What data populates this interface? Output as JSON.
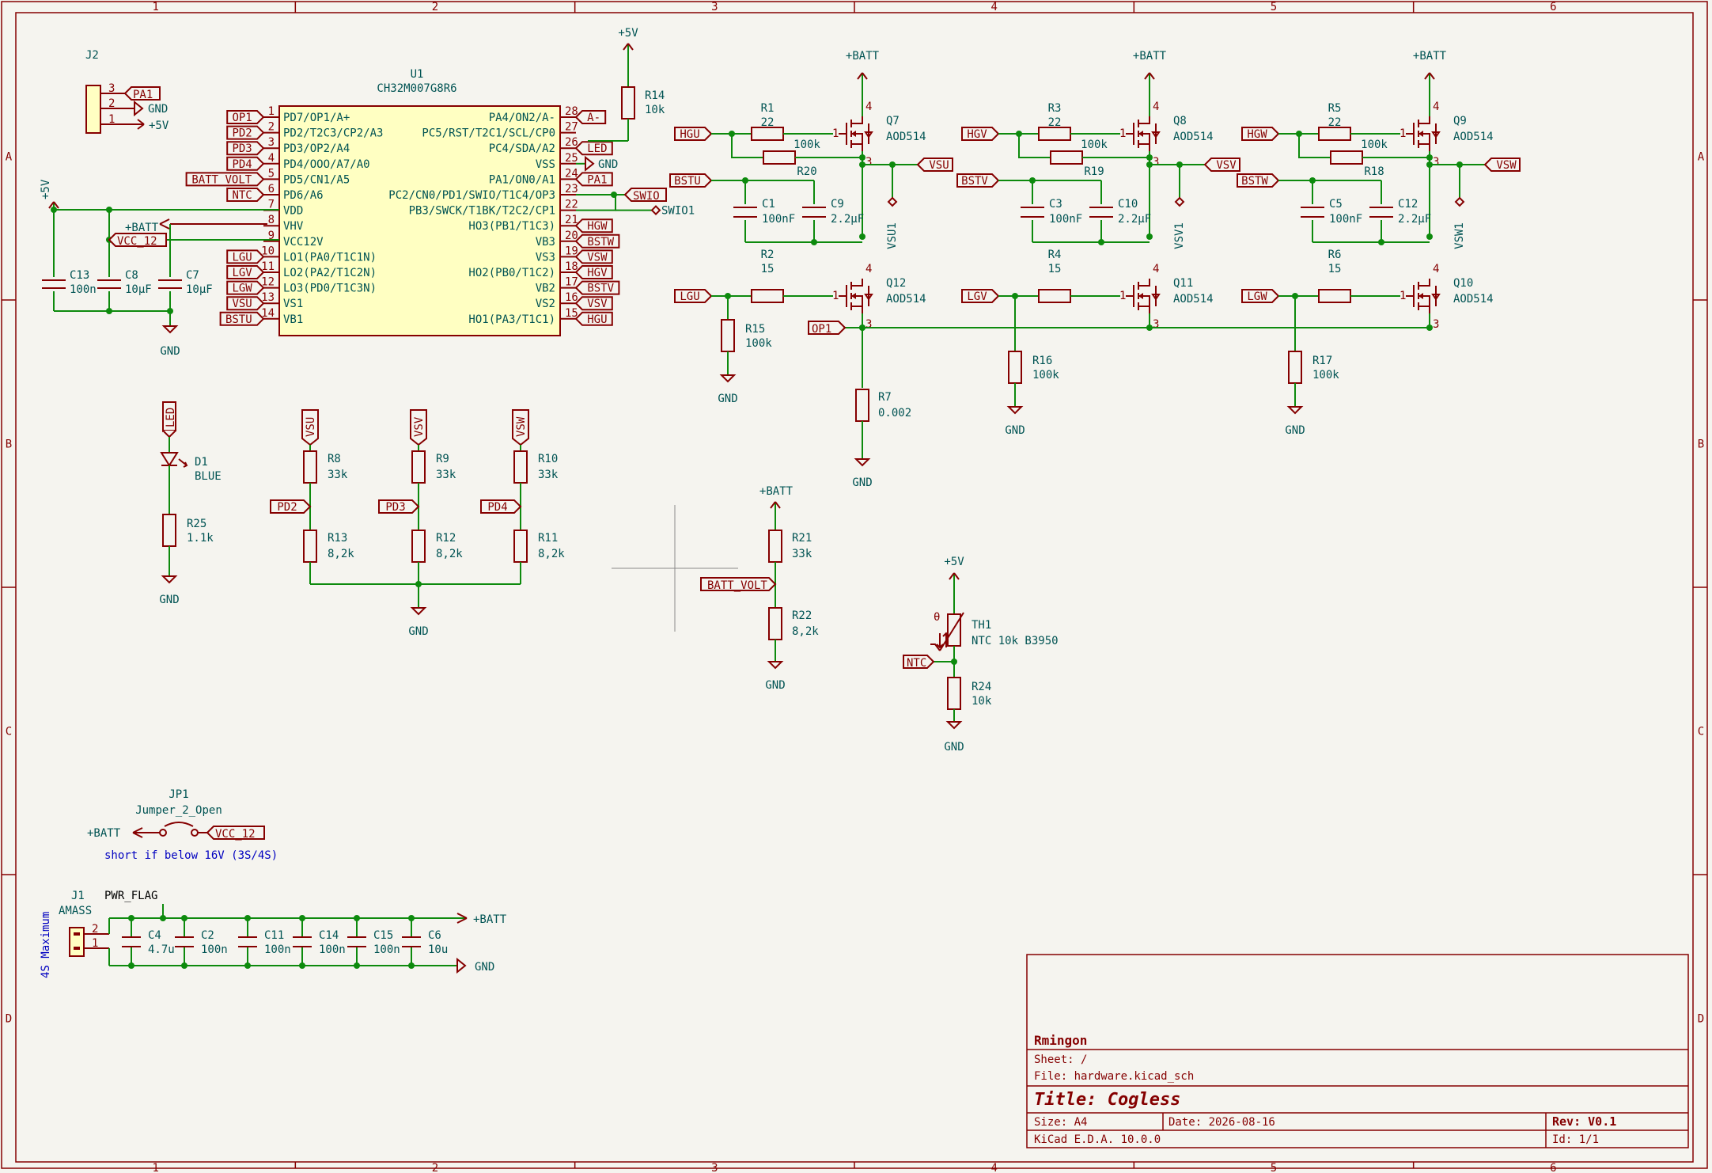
{
  "border": {
    "cols": [
      "1",
      "2",
      "3",
      "4",
      "5",
      "6"
    ],
    "rows": [
      "A",
      "B",
      "C",
      "D"
    ]
  },
  "colors": {
    "wire": "#0d8a0d",
    "symbol": "#850000",
    "text": "#005353",
    "body": "#ffffc2",
    "background": "#f5f4ef",
    "note": "#0000c0"
  },
  "mcu": {
    "ref": "U1",
    "value": "CH32M007G8R6",
    "left_pins": [
      {
        "num": "1",
        "name": "PD7/OP1/A+",
        "net": "OP1"
      },
      {
        "num": "2",
        "name": "PD2/T2C3/CP2/A3",
        "net": "PD2"
      },
      {
        "num": "3",
        "name": "PD3/OP2/A4",
        "net": "PD3"
      },
      {
        "num": "4",
        "name": "PD4/OOO/A7/A0",
        "net": "PD4"
      },
      {
        "num": "5",
        "name": "PD5/CN1/A5",
        "net": "BATT_VOLT"
      },
      {
        "num": "6",
        "name": "PD6/A6",
        "net": "NTC"
      },
      {
        "num": "7",
        "name": "VDD",
        "net": ""
      },
      {
        "num": "8",
        "name": "VHV",
        "net": ""
      },
      {
        "num": "9",
        "name": "VCC12V",
        "net": ""
      },
      {
        "num": "10",
        "name": "LO1(PA0/T1C1N)",
        "net": "LGU"
      },
      {
        "num": "11",
        "name": "LO2(PA2/T1C2N)",
        "net": "LGV"
      },
      {
        "num": "12",
        "name": "LO3(PD0/T1C3N)",
        "net": "LGW"
      },
      {
        "num": "13",
        "name": "VS1",
        "net": "VSU"
      },
      {
        "num": "14",
        "name": "VB1",
        "net": "BSTU"
      }
    ],
    "right_pins": [
      {
        "num": "28",
        "name": "PA4/ON2/A-",
        "net": "A-"
      },
      {
        "num": "27",
        "name": "PC5/RST/T2C1/SCL/CP0",
        "net": ""
      },
      {
        "num": "26",
        "name": "PC4/SDA/A2",
        "net": "LED"
      },
      {
        "num": "25",
        "name": "VSS",
        "net": "GND"
      },
      {
        "num": "24",
        "name": "PA1/ON0/A1",
        "net": "PA1"
      },
      {
        "num": "23",
        "name": "PC2/CN0/PD1/SWIO/T1C4/OP3",
        "net": "SWIO"
      },
      {
        "num": "22",
        "name": "PB3/SWCK/T1BK/T2C2/CP1",
        "net": "SWIO1"
      },
      {
        "num": "21",
        "name": "HO3(PB1/T1C3)",
        "net": "HGW"
      },
      {
        "num": "20",
        "name": "VB3",
        "net": "BSTW"
      },
      {
        "num": "19",
        "name": "VS3",
        "net": "VSW"
      },
      {
        "num": "18",
        "name": "HO2(PB0/T1C2)",
        "net": "HGV"
      },
      {
        "num": "17",
        "name": "VB2",
        "net": "BSTV"
      },
      {
        "num": "16",
        "name": "VS2",
        "net": "VSV"
      },
      {
        "num": "15",
        "name": "HO1(PA3/T1C1)",
        "net": "HGU"
      }
    ]
  },
  "j2": {
    "ref": "J2",
    "pins": [
      "3",
      "2",
      "1"
    ],
    "nets": [
      "PA1",
      "GND",
      "+5V"
    ]
  },
  "power_caps": [
    {
      "ref": "C13",
      "value": "100n"
    },
    {
      "ref": "C8",
      "value": "10μF"
    },
    {
      "ref": "C7",
      "value": "10μF"
    }
  ],
  "phases": [
    {
      "hg": "HGU",
      "bst": "BSTU",
      "lg": "LGU",
      "vs": "VSU",
      "probe": "VSU1",
      "rg1": {
        "ref": "R1",
        "value": "22"
      },
      "rbs": {
        "ref": "R20",
        "value": "100k"
      },
      "c1": {
        "ref": "C1",
        "value": "100nF"
      },
      "c2": {
        "ref": "C9",
        "value": "2.2μF"
      },
      "qh": {
        "ref": "Q7",
        "value": "AOD514"
      },
      "rg2": {
        "ref": "R2",
        "value": "15"
      },
      "ql": {
        "ref": "Q12",
        "value": "AOD514"
      },
      "rpd": {
        "ref": "R15",
        "value": "100k"
      }
    },
    {
      "hg": "HGV",
      "bst": "BSTV",
      "lg": "LGV",
      "vs": "VSV",
      "probe": "VSV1",
      "rg1": {
        "ref": "R3",
        "value": "22"
      },
      "rbs": {
        "ref": "R19",
        "value": "100k"
      },
      "c1": {
        "ref": "C3",
        "value": "100nF"
      },
      "c2": {
        "ref": "C10",
        "value": "2.2μF"
      },
      "qh": {
        "ref": "Q8",
        "value": "AOD514"
      },
      "rg2": {
        "ref": "R4",
        "value": "15"
      },
      "ql": {
        "ref": "Q11",
        "value": "AOD514"
      },
      "rpd": {
        "ref": "R16",
        "value": "100k"
      }
    },
    {
      "hg": "HGW",
      "bst": "BSTW",
      "lg": "LGW",
      "vs": "VSW",
      "probe": "VSW1",
      "rg1": {
        "ref": "R5",
        "value": "22"
      },
      "rbs": {
        "ref": "R18",
        "value": "100k"
      },
      "c1": {
        "ref": "C5",
        "value": "100nF"
      },
      "c2": {
        "ref": "C12",
        "value": "2.2μF"
      },
      "qh": {
        "ref": "Q9",
        "value": "AOD514"
      },
      "rg2": {
        "ref": "R6",
        "value": "15"
      },
      "ql": {
        "ref": "Q10",
        "value": "AOD514"
      },
      "rpd": {
        "ref": "R17",
        "value": "100k"
      }
    }
  ],
  "shunt": {
    "ref": "R7",
    "value": "0.002",
    "net": "OP1"
  },
  "r14": {
    "ref": "R14",
    "value": "10k"
  },
  "dividers": [
    {
      "top": "VSU",
      "mid": "PD2",
      "r1": {
        "ref": "R8",
        "value": "33k"
      },
      "r2": {
        "ref": "R13",
        "value": "8,2k"
      }
    },
    {
      "top": "VSV",
      "mid": "PD3",
      "r1": {
        "ref": "R9",
        "value": "33k"
      },
      "r2": {
        "ref": "R12",
        "value": "8,2k"
      }
    },
    {
      "top": "VSW",
      "mid": "PD4",
      "r1": {
        "ref": "R10",
        "value": "33k"
      },
      "r2": {
        "ref": "R11",
        "value": "8,2k"
      }
    }
  ],
  "led": {
    "net": "LED",
    "ref": "D1",
    "value": "BLUE",
    "r": {
      "ref": "R25",
      "value": "1.1k"
    }
  },
  "batt_div": {
    "top": "+BATT",
    "net": "BATT_VOLT",
    "r1": {
      "ref": "R21",
      "value": "33k"
    },
    "r2": {
      "ref": "R22",
      "value": "8,2k"
    }
  },
  "ntc": {
    "top": "+5V",
    "ref": "TH1",
    "value": "NTC 10k B3950",
    "symbol": "θ",
    "net": "NTC",
    "r": {
      "ref": "R24",
      "value": "10k"
    }
  },
  "jumper": {
    "ref": "JP1",
    "value": "Jumper_2_Open",
    "left": "+BATT",
    "right": "VCC_12",
    "note": "short if below 16V (3S/4S)"
  },
  "input": {
    "ref": "J1",
    "value": "AMASS",
    "side_note": "4S Maximum",
    "pins": [
      "2",
      "1"
    ],
    "flag": "PWR_FLAG",
    "batt": "+BATT",
    "gnd": "GND",
    "caps": [
      {
        "ref": "C4",
        "value": "4.7u"
      },
      {
        "ref": "C2",
        "value": "100n"
      },
      {
        "ref": "C11",
        "value": "100n"
      },
      {
        "ref": "C14",
        "value": "100n"
      },
      {
        "ref": "C15",
        "value": "100n"
      },
      {
        "ref": "C6",
        "value": "10u"
      }
    ]
  },
  "nets": {
    "batt": "+BATT",
    "gnd": "GND",
    "v5": "+5V",
    "vcc12": "VCC_12",
    "pa1": "PA1"
  },
  "titleblock": {
    "company": "Rmingon",
    "sheet": "Sheet: /",
    "file": "File: hardware.kicad_sch",
    "title": "Title: Cogless",
    "size": "Size: A4",
    "date": "Date: 2026-08-16",
    "rev": "Rev: V0.1",
    "tool": "KiCad E.D.A. 10.0.0",
    "id": "Id: 1/1"
  }
}
